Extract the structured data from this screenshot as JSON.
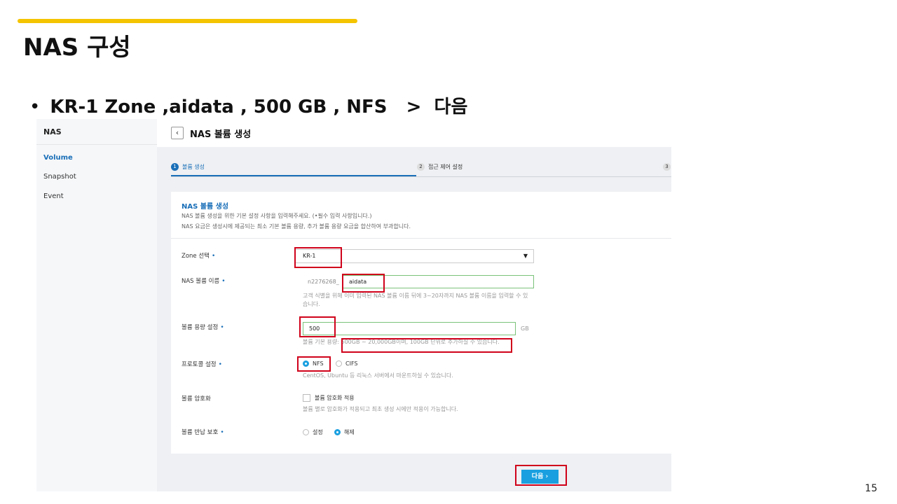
{
  "slide": {
    "title": "NAS 구성",
    "bullet": "KR-1 Zone ,aidata , 500 GB , NFS   >  다음",
    "bullet_symbol": "•",
    "page_number": "15",
    "accent_color": "#f5c400",
    "highlight_color": "#d0021b"
  },
  "sidebar": {
    "title": "NAS",
    "items": [
      {
        "label": "Volume",
        "active": true
      },
      {
        "label": "Snapshot",
        "active": false
      },
      {
        "label": "Event",
        "active": false
      }
    ]
  },
  "header": {
    "back_icon": "‹",
    "title": "NAS 볼륨 생성"
  },
  "steps": [
    {
      "num": "1",
      "label": "볼륨 생성",
      "active": true
    },
    {
      "num": "2",
      "label": "접근 제어 설정",
      "active": false
    },
    {
      "num": "3",
      "label": "",
      "active": false
    }
  ],
  "panel": {
    "title": "NAS 볼륨 생성",
    "desc1": "NAS 볼륨 생성을 위한 기본 설정 사항을 입력해주세요. (•필수 입력 사항입니다.)",
    "desc2": "NAS 요금은 생성시에 제공되는 최소 기본 볼륨 용량, 추가 볼륨 용량 요금을 합산하여 부과합니다."
  },
  "form": {
    "required_mark": "•",
    "zone": {
      "label": "Zone 선택",
      "value": "KR-1",
      "caret": "▼"
    },
    "name": {
      "label": "NAS 볼륨 이름",
      "prefix": "n2276268_",
      "value": "aidata",
      "hint_line1": "고객 식별을 위해 이미 입력된 NAS 볼륨 이름 뒤에 3~20자까지 NAS 볼륨 이름을 입력할 수 있",
      "hint_line2": "습니다."
    },
    "capacity": {
      "label": "볼륨 용량 설정",
      "value": "500",
      "unit": "GB",
      "hint": "볼륨 기본 용량: 500GB ~ 20,000GB이며, 100GB 단위로 추가하실 수 있습니다."
    },
    "protocol": {
      "label": "프로토콜 설정",
      "options": [
        "NFS",
        "CIFS"
      ],
      "selected": "NFS",
      "hint": "CentOS, Ubuntu 등 리눅스 서버에서 마운트하실 수 있습니다."
    },
    "encryption": {
      "label": "볼륨 암호화",
      "checkbox_label": "볼륨 암호화 적용",
      "checked": false,
      "hint": "볼륨 별로 암호화가 적용되고 최초 생성 시에만 적용이 가능합니다."
    },
    "return_protection": {
      "label": "볼륨 반납 보호",
      "options": [
        "설정",
        "해제"
      ],
      "selected": "해제"
    }
  },
  "actions": {
    "next_label": "다음  ›"
  }
}
